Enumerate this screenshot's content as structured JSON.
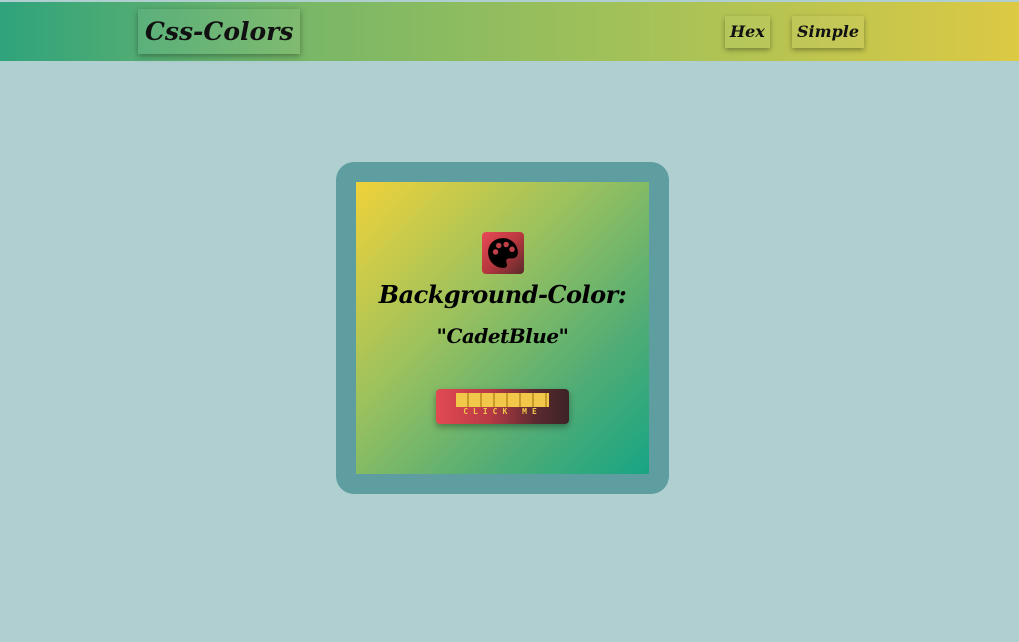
{
  "navbar": {
    "brand": "Css-Colors",
    "links": [
      {
        "label": "Hex"
      },
      {
        "label": "Simple"
      }
    ],
    "gradient": [
      "#2fa37c",
      "#dcc944"
    ]
  },
  "page": {
    "background": "#afcfd0"
  },
  "card": {
    "frame_color": "#5f9ea0",
    "icon": "palette-icon",
    "title": "Background-Color:",
    "color_name": "\"CadetBlue\"",
    "button_label": "CLICK ME"
  }
}
